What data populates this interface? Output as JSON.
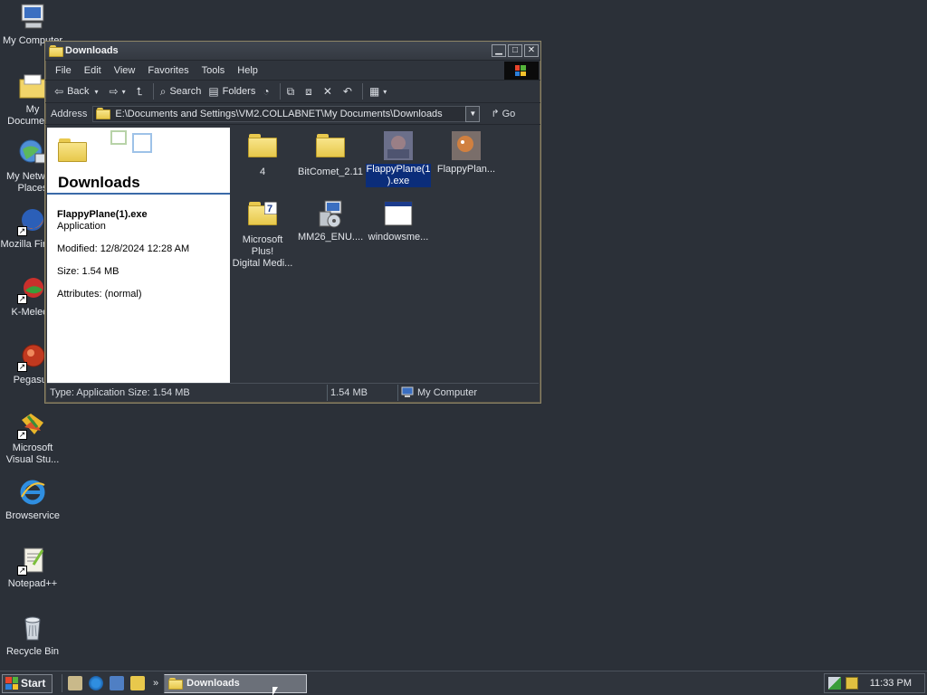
{
  "desktop": {
    "icons": [
      {
        "label": "My Computer"
      },
      {
        "label": "My Documents"
      },
      {
        "label": "My Network Places"
      },
      {
        "label": "Mozilla Firefox"
      },
      {
        "label": "K-Meleon"
      },
      {
        "label": "Pegasus"
      },
      {
        "label": "Microsoft\nVisual Stu..."
      },
      {
        "label": "Browservice"
      },
      {
        "label": "Notepad++"
      },
      {
        "label": "Recycle Bin"
      }
    ]
  },
  "window": {
    "title": "Downloads",
    "menu": [
      "File",
      "Edit",
      "View",
      "Favorites",
      "Tools",
      "Help"
    ],
    "toolbar": {
      "back": "Back",
      "search": "Search",
      "folders": "Folders"
    },
    "address": {
      "label": "Address",
      "path": "E:\\Documents and Settings\\VM2.COLLABNET\\My Documents\\Downloads",
      "go": "Go"
    },
    "tasks": {
      "title": "Downloads",
      "selected_name": "FlappyPlane(1).exe",
      "selected_type": "Application",
      "modified": "Modified: 12/8/2024 12:28 AM",
      "size": "Size: 1.54 MB",
      "attributes": "Attributes: (normal)"
    },
    "files": [
      {
        "label": "4",
        "icon": "folder-icon"
      },
      {
        "label": "BitComet_2.11",
        "icon": "folder-icon"
      },
      {
        "label": "FlappyPlane(1\n).exe",
        "icon": "app-icon",
        "selected": true
      },
      {
        "label": "FlappyPlan...",
        "icon": "app-icon"
      },
      {
        "label": "Microsoft Plus!\nDigital Medi...",
        "icon": "folder-icon"
      },
      {
        "label": "MM26_ENU....",
        "icon": "installer-icon"
      },
      {
        "label": "windowsme...",
        "icon": "window-icon"
      }
    ],
    "status": {
      "left": "Type: Application Size: 1.54 MB",
      "size": "1.54 MB",
      "zone": "My Computer"
    }
  },
  "taskbar": {
    "start": "Start",
    "quicklaunch_more": "»",
    "task": "Downloads",
    "clock": "11:33 PM"
  },
  "colors": {
    "desktop": "#2b3038",
    "selection": "#0b2d7a",
    "window_border": "#8d8466"
  }
}
